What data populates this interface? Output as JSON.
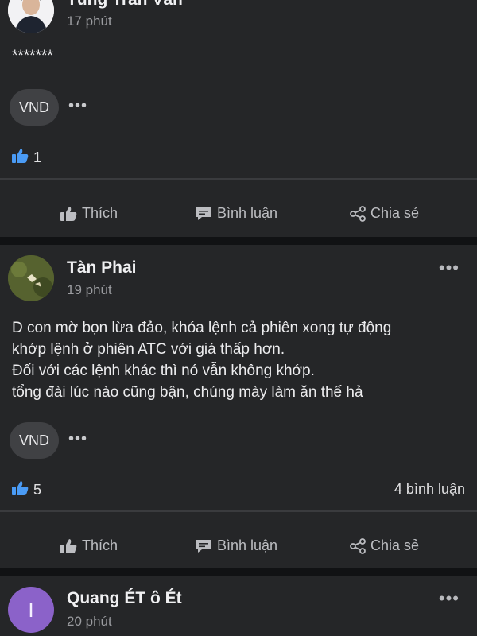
{
  "posts": [
    {
      "author": "Tùng Trần Văn",
      "time": "17 phút",
      "text_lines": [
        "*******"
      ],
      "tag": "VND",
      "likes": "1",
      "comments": ""
    },
    {
      "author": "Tàn Phai",
      "time": "19 phút",
      "text_lines": [
        "D con mờ bọn lừa đảo, khóa lệnh cả phiên xong tự động",
        "khớp lệnh ở phiên ATC với giá thấp hơn.",
        "Đối với các lệnh khác thì nó vẫn không khớp.",
        "tổng đài lúc nào cũng bận, chúng mày làm ăn thế hả"
      ],
      "tag": "VND",
      "likes": "5",
      "comments": "4 bình luận"
    },
    {
      "author": "Quang ÉT ô Ét",
      "time": "20 phút",
      "avatar_letter": "I"
    }
  ],
  "actions": {
    "like": "Thích",
    "comment": "Bình luận",
    "share": "Chia sẻ"
  },
  "more_glyph": "•••",
  "colors": {
    "background": "#111214",
    "card": "#252628",
    "accent_like": "#4a9bf5",
    "avatar_purple": "#8b62c9"
  },
  "icons": [
    "thumbs-up-icon",
    "chat-icon",
    "share-icon",
    "more-icon"
  ]
}
